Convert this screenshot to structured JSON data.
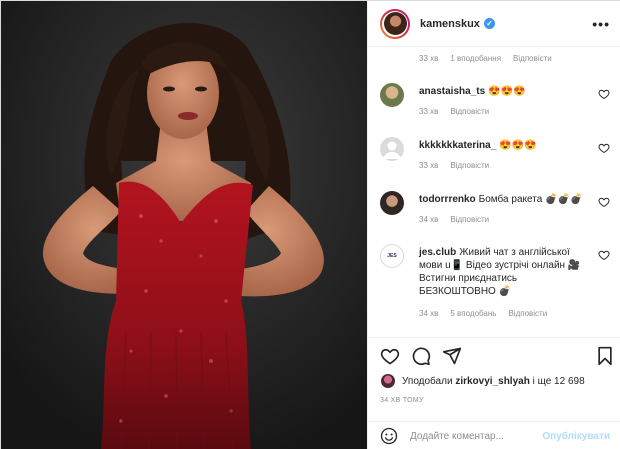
{
  "header": {
    "username": "kamenskux"
  },
  "top_comment_meta": {
    "time": "33 хв",
    "likes": "1 вподобання",
    "reply": "Відповісти"
  },
  "comments": [
    {
      "user": "anastaisha_ts",
      "text": "😍😍😍",
      "time": "33 хв",
      "reply": "Відповісти"
    },
    {
      "user": "kkkkkkkaterina_",
      "text": "😍😍😍",
      "time": "33 хв",
      "reply": "Відповісти"
    },
    {
      "user": "todorrrenko",
      "text": "Бомба ракета 💣💣💣",
      "time": "34 хв",
      "reply": "Відповісти"
    },
    {
      "user": "jes.club",
      "text": "Живий чат з англійської мови u📱 Відео зустрічі онлайн 🎥 Встигни приєднатись БЕЗКОШТОВНО 💣",
      "time": "34 хв",
      "likes": "5 вподобань",
      "reply": "Відповісти",
      "avatar_text": "JES"
    }
  ],
  "likes": {
    "prefix": "Уподобали",
    "user": "zirkovyi_shlyah",
    "suffix": "і ще 12 698"
  },
  "timestamp": "34 ХВ ТОМУ",
  "add_comment": {
    "placeholder": "Додайте коментар...",
    "post_label": "Опублікувати"
  },
  "colors": {
    "accent": "#3897f0",
    "dress": "#a8121c",
    "background": "#262626"
  }
}
